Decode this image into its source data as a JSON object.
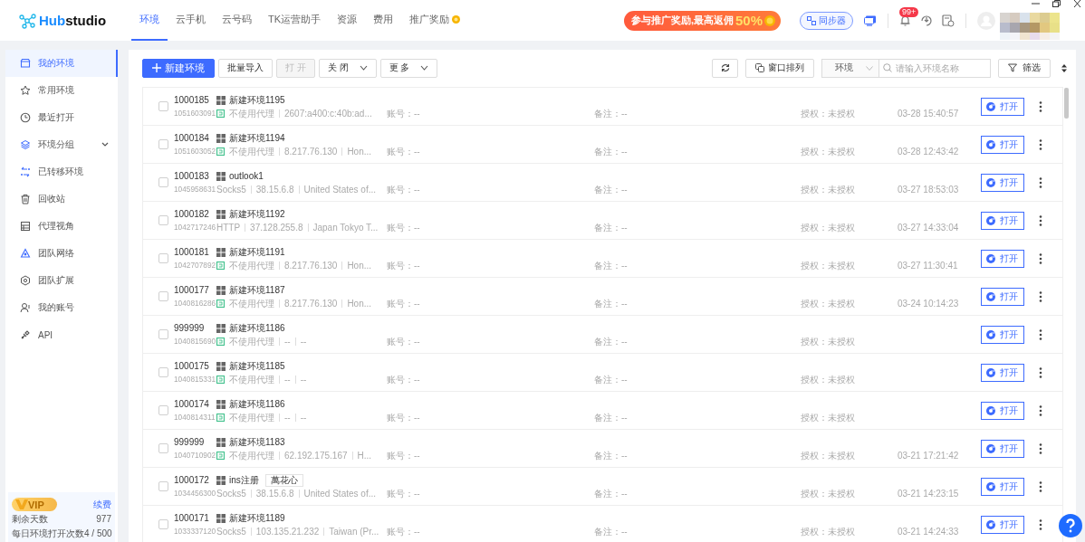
{
  "app": {
    "logo_part_1": "Hub",
    "logo_part_2": "studio"
  },
  "nav_tabs": [
    {
      "label": "环境",
      "selected": true
    },
    {
      "label": "云手机",
      "selected": false
    },
    {
      "label": "云号码",
      "selected": false
    },
    {
      "label": "TK运营助手",
      "selected": false
    },
    {
      "label": "资源",
      "selected": false
    },
    {
      "label": "费用",
      "selected": false
    },
    {
      "label": "推广奖励",
      "selected": false,
      "coin": true
    }
  ],
  "promo": {
    "text": "参与推广奖励,最高返佣",
    "highlight": "50%"
  },
  "sync_button": "同步器",
  "notifications": {
    "badge": "99+"
  },
  "sidebar": {
    "items": [
      {
        "label": "我的环境",
        "selected": true
      },
      {
        "label": "常用环境",
        "selected": false
      },
      {
        "label": "最近打开",
        "selected": false
      },
      {
        "label": "环境分组",
        "selected": false,
        "expanded": false
      },
      {
        "label": "已转移环境",
        "selected": false
      },
      {
        "label": "回收站",
        "selected": false
      },
      {
        "label": "代理视角",
        "selected": false
      },
      {
        "label": "团队网络",
        "selected": false
      },
      {
        "label": "团队扩展",
        "selected": false
      },
      {
        "label": "我的账号",
        "selected": false
      },
      {
        "label": "API",
        "selected": false
      }
    ],
    "vip": {
      "badge": "VIP",
      "renew": "续费",
      "stats": [
        {
          "label": "剩余天数",
          "value": "977"
        },
        {
          "label": "每日环境打开次数",
          "value": "4 / 500"
        }
      ]
    }
  },
  "toolbar": {
    "left": [
      {
        "kind": "primary",
        "label": "新建环境",
        "disabled": false
      },
      {
        "kind": "plain",
        "label": "批量导入",
        "disabled": false
      },
      {
        "kind": "plain",
        "label": "打 开",
        "disabled": true
      },
      {
        "kind": "dropdown",
        "label": "关 闭",
        "disabled": false
      },
      {
        "kind": "dropdown",
        "label": "更 多",
        "disabled": false
      }
    ],
    "arrange": "窗口排列",
    "scope": "环境",
    "search": {
      "placeholder": "请输入环境名称"
    },
    "filter": "筛选"
  },
  "rows": [
    {
      "id": "1000185",
      "serial": "1051603091",
      "name": "新建环境1195",
      "proxy_icon": true,
      "proxy": "不使用代理",
      "ip": "2607:a400:c:40b:ad...",
      "account": "账号：--",
      "notes": "备注：--",
      "auth": "授权：未授权",
      "time": "03-28 15:40:57",
      "open": "打开",
      "checked": false
    },
    {
      "id": "1000184",
      "serial": "1051603052",
      "name": "新建环境1194",
      "proxy_icon": true,
      "proxy": "不使用代理",
      "ip": "8.217.76.130",
      "location": "Hon...",
      "account": "账号：--",
      "notes": "备注：--",
      "auth": "授权：未授权",
      "time": "03-28 12:43:42",
      "open": "打开",
      "checked": false
    },
    {
      "id": "1000183",
      "serial": "1045958631",
      "name": "outlook1",
      "proxy_icon": false,
      "proxy": "Socks5",
      "ip": "38.15.6.8",
      "location": "United States of...",
      "account": "账号：--",
      "notes": "备注：--",
      "auth": "授权：未授权",
      "time": "03-27 18:53:03",
      "open": "打开",
      "checked": false
    },
    {
      "id": "1000182",
      "serial": "1042717246",
      "name": "新建环境1192",
      "proxy_icon": false,
      "proxy": "HTTP",
      "ip": "37.128.255.8",
      "location": "Japan Tokyo T...",
      "account": "账号：--",
      "notes": "备注：--",
      "auth": "授权：未授权",
      "time": "03-27 14:33:04",
      "open": "打开",
      "checked": false
    },
    {
      "id": "1000181",
      "serial": "1042707892",
      "name": "新建环境1191",
      "proxy_icon": true,
      "proxy": "不使用代理",
      "ip": "8.217.76.130",
      "location": "Hon...",
      "account": "账号：--",
      "notes": "备注：--",
      "auth": "授权：未授权",
      "time": "03-27 11:30:41",
      "open": "打开",
      "checked": false
    },
    {
      "id": "1000177",
      "serial": "1040816286",
      "name": "新建环境1187",
      "proxy_icon": true,
      "proxy": "不使用代理",
      "ip": "8.217.76.130",
      "location": "Hon...",
      "account": "账号：--",
      "notes": "备注：--",
      "auth": "授权：未授权",
      "time": "03-24 10:14:23",
      "open": "打开",
      "checked": false
    },
    {
      "id": "999999",
      "serial": "1040815690",
      "name": "新建环境1186",
      "proxy_icon": true,
      "proxy": "不使用代理",
      "ip": "--",
      "location": "--",
      "account": "账号：--",
      "notes": "备注：--",
      "auth": "授权：未授权",
      "open": "打开",
      "checked": false
    },
    {
      "id": "1000175",
      "serial": "1040815331",
      "name": "新建环境1185",
      "proxy_icon": true,
      "proxy": "不使用代理",
      "ip": "--",
      "location": "--",
      "account": "账号：--",
      "notes": "备注：--",
      "auth": "授权：未授权",
      "open": "打开",
      "checked": false
    },
    {
      "id": "1000174",
      "serial": "1040814311",
      "name": "新建环境1186",
      "proxy_icon": true,
      "proxy": "不使用代理",
      "ip": "--",
      "location": "--",
      "account": "账号：--",
      "notes": "备注：--",
      "auth": "授权：未授权",
      "open": "打开",
      "checked": false
    },
    {
      "id": "999999",
      "serial": "1040710902",
      "name": "新建环境1183",
      "proxy_icon": true,
      "proxy": "不使用代理",
      "ip": "62.192.175.167",
      "location": "H...",
      "account": "账号：--",
      "notes": "备注：--",
      "auth": "授权：未授权",
      "time": "03-21 17:21:42",
      "open": "打开",
      "checked": false
    },
    {
      "id": "1000172",
      "serial": "1034456300",
      "name": "ins注册",
      "tag": "萬花心",
      "proxy_icon": false,
      "proxy": "Socks5",
      "ip": "38.15.6.8",
      "location": "United States of...",
      "account": "账号：--",
      "notes": "备注：--",
      "auth": "授权：未授权",
      "time": "03-21 14:23:15",
      "open": "打开",
      "checked": false
    },
    {
      "id": "1000171",
      "serial": "1033337120",
      "name": "新建环境1189",
      "proxy_icon": false,
      "proxy": "Socks5",
      "ip": "103.135.21.232",
      "location": "Taiwan (Pr...",
      "account": "账号：--",
      "notes": "备注：--",
      "auth": "授权：未授权",
      "time": "03-21 14:24:33",
      "open": "打开",
      "checked": false
    }
  ]
}
